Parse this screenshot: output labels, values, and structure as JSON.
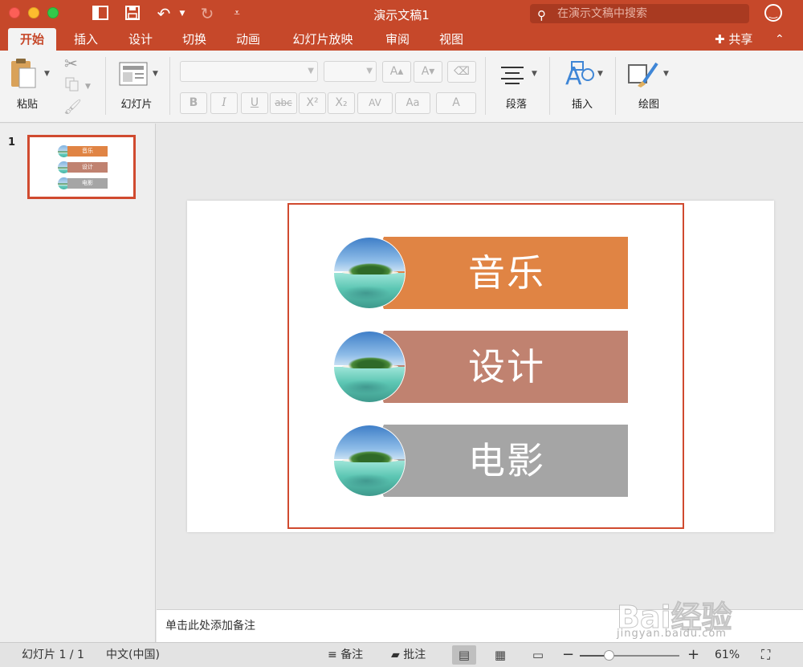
{
  "window": {
    "title": "演示文稿1",
    "search_placeholder": "在演示文稿中搜索"
  },
  "tabs": [
    "开始",
    "插入",
    "设计",
    "切换",
    "动画",
    "幻灯片放映",
    "审阅",
    "视图"
  ],
  "active_tab": "开始",
  "share_label": "共享",
  "ribbon": {
    "paste_label": "粘贴",
    "slide_label": "幻灯片",
    "paragraph_label": "段落",
    "insert_label": "插入",
    "drawing_label": "绘图",
    "format_buttons": [
      "B",
      "I",
      "U",
      "abc",
      "X²",
      "X₂",
      "AV",
      "Aa",
      "A"
    ]
  },
  "thumbnails": [
    {
      "number": "1",
      "labels": [
        "音乐",
        "设计",
        "电影"
      ]
    }
  ],
  "slide": {
    "items": [
      {
        "label": "音乐",
        "color": "#e08444"
      },
      {
        "label": "设计",
        "color": "#c08270"
      },
      {
        "label": "电影",
        "color": "#a5a5a5"
      }
    ]
  },
  "notes_placeholder": "单击此处添加备注",
  "status": {
    "slide_info": "幻灯片 1 / 1",
    "language": "中文(中国)",
    "notes_label": "备注",
    "comments_label": "批注",
    "zoom": "61%",
    "zoom_fraction": 0.3
  },
  "watermark": {
    "main": "Bai经验",
    "sub": "jingyan.baidu.com"
  },
  "colors": {
    "accent": "#c6482a",
    "selection": "#d04a2f"
  }
}
